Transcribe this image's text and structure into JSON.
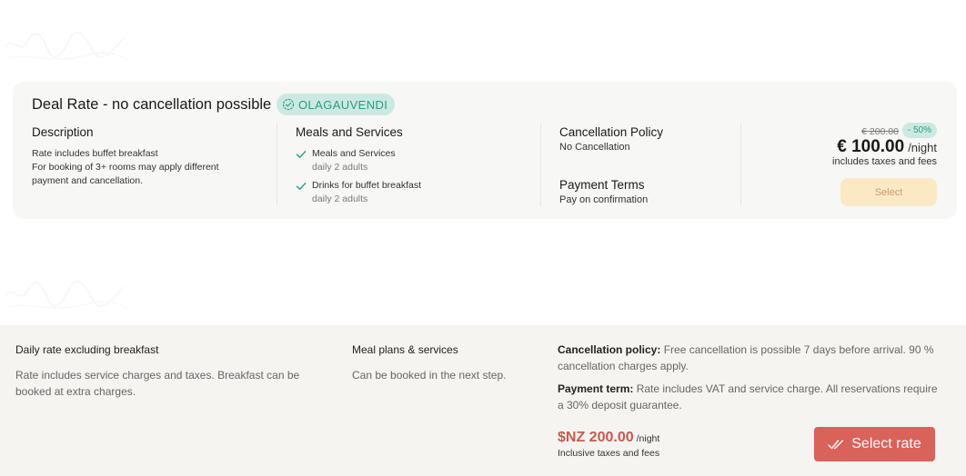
{
  "card1": {
    "title": "Deal Rate - no cancellation possible",
    "coupon_code": "OLAGAUVENDI",
    "description": {
      "heading": "Description",
      "line1": "Rate includes buffet breakfast",
      "line2": "For booking of 3+ rooms may apply different",
      "line3": "payment and cancellation."
    },
    "meals": {
      "heading": "Meals and Services",
      "items": [
        {
          "label": "Meals and Services",
          "sub": "daily 2 adults"
        },
        {
          "label": "Drinks for buffet breakfast",
          "sub": "daily 2 adults"
        }
      ]
    },
    "cancellation": {
      "heading": "Cancellation Policy",
      "text": "No Cancellation"
    },
    "payment": {
      "heading": "Payment Terms",
      "text": "Pay on confirmation"
    },
    "price": {
      "old": "€ 200.00",
      "discount": "- 50%",
      "current": "€ 100.00",
      "unit": "/night",
      "note": "includes taxes and fees"
    },
    "select_label": "Select",
    "colors": {
      "accent_teal": "#2b9a82",
      "badge_bg": "#cbe9e2",
      "select_bg": "#fbe9c3"
    }
  },
  "card2": {
    "col1": {
      "heading": "Daily rate excluding breakfast",
      "line1": "Rate includes service charges and taxes. Breakfast can be",
      "line2": "booked at extra charges."
    },
    "col2": {
      "heading": "Meal plans & services",
      "text": "Can be booked in the next step."
    },
    "cancellation": {
      "label": "Cancellation policy:",
      "line1": " Free cancellation is possible 7 days before arrival. 90 %",
      "line2": "cancellation charges apply."
    },
    "payment": {
      "label": "Payment term:",
      "line1": " Rate includes VAT and service charge. All reservations require",
      "line2": "a 30% deposit guarantee."
    },
    "price": {
      "value": "$NZ 200.00",
      "unit": "/night",
      "note": "Inclusive taxes and fees"
    },
    "select_label": "Select rate",
    "colors": {
      "price": "#c8594f",
      "button_bg": "#d9625a"
    }
  }
}
